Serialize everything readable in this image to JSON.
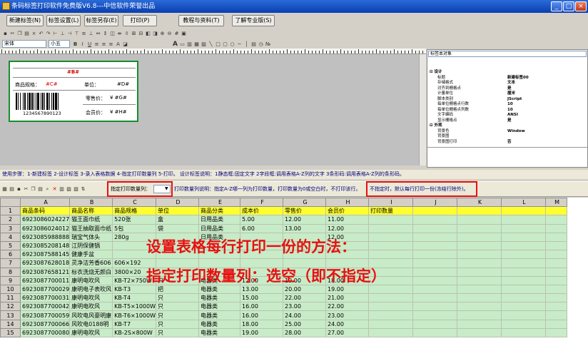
{
  "window": {
    "title": "条码标签打印软件免费版V6.8---中信软件荣誉出品",
    "min": "_",
    "max": "□",
    "close": "×"
  },
  "toolbar_buttons": [
    "新建标签(N)",
    "标签设置(L)",
    "标签另存(E)",
    "打印(P)",
    "教程与资料(T)",
    "了解专业版(S)"
  ],
  "font": {
    "name": "宋体",
    "size": "小五",
    "bold": "B",
    "italic": "I",
    "underline": "U"
  },
  "label": {
    "title": "#B#",
    "spec_label": "商品规格：",
    "spec_value": "#C#",
    "unit_label": "单位：",
    "unit_value": "#D#",
    "retail_label": "零售价：",
    "retail_value": "¥ #G#",
    "member_label": "会员价：",
    "member_value": "¥ #H#",
    "barcode_text": "1234567890123"
  },
  "properties": {
    "selector": "标签本对象",
    "rows": [
      {
        "sec": "⊟ 设计"
      },
      {
        "k": "标题",
        "v": "新建标签00"
      },
      {
        "k": "存储格式",
        "v": "文本"
      },
      {
        "k": "对齐到栅格点",
        "v": "是"
      },
      {
        "k": "计量单位",
        "v": "厘米"
      },
      {
        "k": "脚本类别",
        "v": "JScript"
      },
      {
        "k": "每单位栅格点行数",
        "v": "10"
      },
      {
        "k": "每单位栅格点列数",
        "v": "10"
      },
      {
        "k": "文字编码",
        "v": "ANSI"
      },
      {
        "k": "显示栅格点",
        "v": "是"
      },
      {
        "sec": "⊟ 外观"
      },
      {
        "k": "背景色",
        "v": "Window"
      },
      {
        "k": "背景图",
        "v": ""
      },
      {
        "k": "背景图打印",
        "v": "否"
      }
    ]
  },
  "steps_text": "使用步骤：1-新建标签 2-设计标签 3-录入表格数据 4-指定打印数量列 5-打印。 设计标签说明：1静态框:固定文字 2字段框:调用表格A-Z列的文字 3条形码:调用表格A-Z列的条形码。",
  "print_qty": {
    "label": "指定打印数量列：",
    "value": "",
    "desc": "打印数量列说明：指定A-Z哪一列为打印数量，打印数量为0或空白时，不打印该行。",
    "note": "不指定时，默认每行打印一份(冻结行除外)。"
  },
  "overlay": {
    "line1": "设置表格每行打印一份的方法：",
    "line2": "指定打印数量列：选空（即不指定）"
  },
  "grid": {
    "col_letters": [
      "A",
      "B",
      "C",
      "D",
      "E",
      "F",
      "G",
      "H",
      "I",
      "J",
      "K",
      "L",
      "M"
    ],
    "headers": [
      "商品条码",
      "商品名称",
      "商品规格",
      "单位",
      "商品分类",
      "成本价",
      "零售价",
      "会员价",
      "打印数量"
    ],
    "rows": [
      [
        "6923086024227",
        "猫王面巾纸",
        "520张",
        "盒",
        "日用品类",
        "5.00",
        "12.00",
        "11.00"
      ],
      [
        "6923086024012",
        "猫王抽取面巾纸",
        "5包",
        "袋",
        "日用品类",
        "6.00",
        "13.00",
        "12.00"
      ],
      [
        "6923085988888",
        "瑞宝气体头",
        "280g",
        "",
        "日用品类",
        "",
        "",
        "12.00"
      ],
      [
        "6923085208148",
        "江阴保健锅",
        "",
        "",
        "",
        "",
        "",
        ""
      ],
      [
        "6923087588145",
        "健康手盆",
        "",
        "",
        "",
        "",
        "",
        ""
      ],
      [
        "6923087628018",
        "灵净洁芳香606",
        "606×192",
        "",
        "",
        "",
        "",
        ""
      ],
      [
        "6923087658121",
        "标衣洗烧无颜白",
        "3800×20",
        "",
        "",
        "",
        "",
        ""
      ],
      [
        "6923087700011",
        "康明电吹风",
        "KB-T2×750W",
        "只",
        "电器类",
        "12.00",
        "19.00",
        "18.00"
      ],
      [
        "6923087700029",
        "康明电子表吹风",
        "KB-T3",
        "把",
        "电器类",
        "13.00",
        "20.00",
        "19.00"
      ],
      [
        "6923087700031",
        "康明电吹风",
        "KB-T4",
        "只",
        "电器类",
        "15.00",
        "22.00",
        "21.00"
      ],
      [
        "6923087700042",
        "康明电吹风",
        "KB-T5×1000W",
        "只",
        "电器类",
        "16.00",
        "23.00",
        "22.00"
      ],
      [
        "6923087700059",
        "风吹电风豪明康",
        "KB-T6×1000W",
        "只",
        "电器类",
        "16.00",
        "24.00",
        "23.00"
      ],
      [
        "6923087700066",
        "风吹电0188明",
        "KB-T7",
        "只",
        "电器类",
        "18.00",
        "25.00",
        "24.00"
      ],
      [
        "6923087700080",
        "康明电吹风",
        "KB-2S×800W",
        "只",
        "电器类",
        "19.00",
        "28.00",
        "27.00"
      ]
    ]
  },
  "colors": {
    "accent_red": "#e81010",
    "label_border": "#1a8c2c",
    "grid_green": "#c8ebc8",
    "header_yellow": "#ffff30"
  }
}
